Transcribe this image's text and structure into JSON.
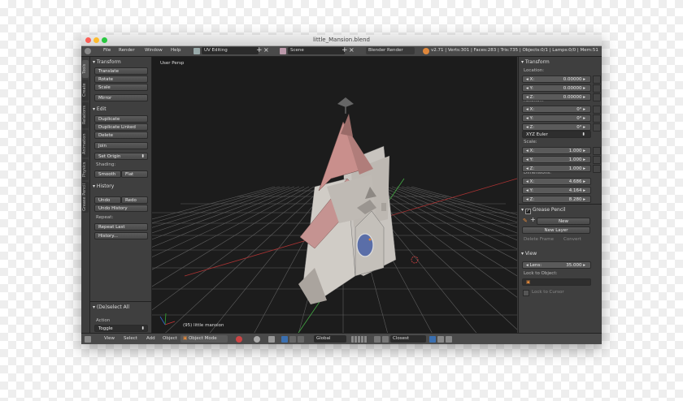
{
  "window": {
    "title": "little_Mansion.blend"
  },
  "infobar": {
    "menus": [
      "File",
      "Render",
      "Window",
      "Help"
    ],
    "layout": "UV Editing",
    "scene": "Scene",
    "engine": "Blender Render",
    "stats": "v2.71 | Verts:301 | Faces:283 | Tris:735 | Objects:0/1 | Lamps:0/0 | Mem:51"
  },
  "vtabs": [
    "Tools",
    "Create",
    "Relations",
    "Animation",
    "Physics",
    "Grease Pencil"
  ],
  "tools": {
    "transform_header": "Transform",
    "translate": "Translate",
    "rotate": "Rotate",
    "scale": "Scale",
    "mirror": "Mirror",
    "edit_header": "Edit",
    "duplicate": "Duplicate",
    "duplicate_linked": "Duplicate Linked",
    "delete": "Delete",
    "join": "Join",
    "set_origin": "Set Origin",
    "shading_label": "Shading:",
    "smooth": "Smooth",
    "flat": "Flat",
    "history_header": "History",
    "undo": "Undo",
    "redo": "Redo",
    "undo_history": "Undo History",
    "repeat_label": "Repeat:",
    "repeat_last": "Repeat Last",
    "history_btn": "History...",
    "deselect_header": "(De)select All",
    "action_label": "Action",
    "action_value": "Toggle"
  },
  "viewport": {
    "label": "User Persp",
    "object_label": "(95) little mansion"
  },
  "properties": {
    "transform_header": "Transform",
    "location_label": "Location:",
    "location": [
      {
        "axis": "X:",
        "value": "0.00000"
      },
      {
        "axis": "Y:",
        "value": "0.00000"
      },
      {
        "axis": "Z:",
        "value": "0.00000"
      }
    ],
    "rotation_label": "Rotation:",
    "rotation": [
      {
        "axis": "X:",
        "value": "0°"
      },
      {
        "axis": "Y:",
        "value": "0°"
      },
      {
        "axis": "Z:",
        "value": "0°"
      }
    ],
    "rotation_mode": "XYZ Euler",
    "scale_label": "Scale:",
    "scale": [
      {
        "axis": "X:",
        "value": "1.000"
      },
      {
        "axis": "Y:",
        "value": "1.000"
      },
      {
        "axis": "Z:",
        "value": "1.000"
      }
    ],
    "dimensions_label": "Dimensions:",
    "dimensions": [
      {
        "axis": "X:",
        "value": "4.686"
      },
      {
        "axis": "Y:",
        "value": "4.164"
      },
      {
        "axis": "Z:",
        "value": "8.280"
      }
    ],
    "grease_header": "Grease Pencil",
    "new": "New",
    "new_layer": "New Layer",
    "delete_frame": "Delete Frame",
    "convert": "Convert",
    "view_header": "View",
    "lens": "Lens:",
    "lens_value": "35.000",
    "lock_to_object": "Lock to Object:",
    "lock_to_cursor": "Lock to Cursor"
  },
  "bottombar": {
    "menus": [
      "View",
      "Select",
      "Add",
      "Object"
    ],
    "mode": "Object Mode",
    "pivot": "Global",
    "snap": "Closest"
  },
  "colors": {
    "accent": "#e0883c",
    "roof": "#c98f8c",
    "stone": "#c8c4bf",
    "grid": "#6a6a6a",
    "viewport_bg": "#1c1c1c"
  }
}
